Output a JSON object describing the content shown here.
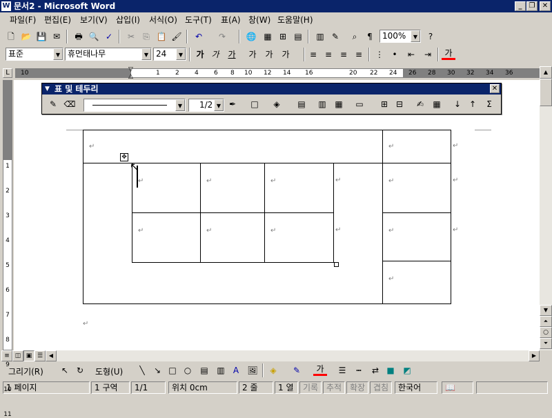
{
  "window": {
    "title": "문서2 - Microsoft Word"
  },
  "menu": [
    "파일(F)",
    "편집(E)",
    "보기(V)",
    "삽입(I)",
    "서식(O)",
    "도구(T)",
    "표(A)",
    "창(W)",
    "도움말(H)"
  ],
  "standard_toolbar": {
    "zoom": "100%"
  },
  "format_toolbar": {
    "style": "표준",
    "font": "휴먼태나무",
    "size": "24",
    "font_color_glyph": "가"
  },
  "ruler": {
    "ticks": [
      "10",
      "1",
      "2",
      "4",
      "6",
      "8",
      "10",
      "12",
      "14",
      "16",
      "20",
      "22",
      "24",
      "26",
      "28",
      "30",
      "32",
      "34",
      "36"
    ]
  },
  "table_toolbar": {
    "title": "표 및 테두리",
    "line_weight": "1/2",
    "sum": "Σ"
  },
  "vruler": {
    "ticks": [
      "1",
      "2",
      "3",
      "4",
      "5",
      "6",
      "7",
      "8",
      "9",
      "10",
      "11"
    ]
  },
  "drawing_toolbar": {
    "draw": "그리기(R)",
    "shapes": "도형(U)",
    "font_color_glyph": "가"
  },
  "status": {
    "page": "1 페이지",
    "section": "1 구역",
    "page_of": "1/1",
    "position": "위치 0cm",
    "line": "2 줄",
    "col": "1 열",
    "rec": "기록",
    "trk": "추적",
    "ext": "확장",
    "ovr": "겹침",
    "lang": "한국어"
  },
  "doc": {
    "para_mark": "↵"
  }
}
